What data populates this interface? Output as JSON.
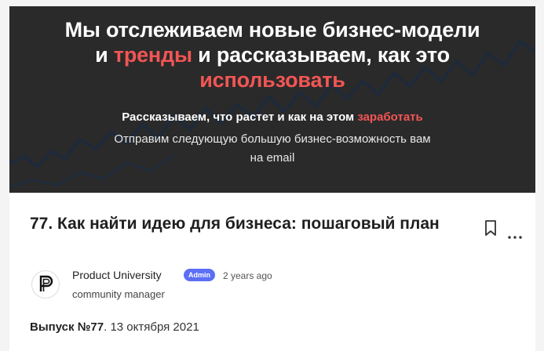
{
  "banner": {
    "headline_line1": "Мы отслеживаем новые бизнес-модели",
    "headline_line2_a": "и ",
    "headline_line2_red": "тренды",
    "headline_line2_b": " и рассказываем, как это",
    "headline_line3_red": "использовать",
    "sub1_text": "Рассказываем, что растет и как на этом ",
    "sub1_red": "заработать",
    "sub2_line1": "Отправим следующую большую бизнес-возможность вам",
    "sub2_line2": "на email",
    "colors": {
      "background": "#2a2a2a",
      "accent": "#f25555",
      "chart_line": "#1e2a3a"
    }
  },
  "post": {
    "title": "77. Как найти идею для бизнеса: пошаговый план",
    "bookmark_icon": "bookmark-icon",
    "more_icon": "more-horizontal-icon"
  },
  "author": {
    "name": "Product University",
    "badge": "Admin",
    "time": "2 years ago",
    "role": "community manager",
    "badge_color": "#5b6ef5"
  },
  "issue": {
    "label": "Выпуск №77",
    "date": ". 13 октября 2021"
  }
}
